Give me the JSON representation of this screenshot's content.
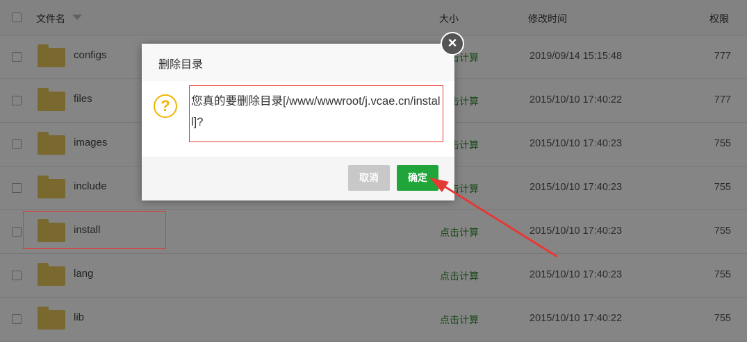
{
  "header": {
    "name": "文件名",
    "size": "大小",
    "mtime": "修改时间",
    "perm": "权限"
  },
  "rows": [
    {
      "name": "configs",
      "size": "点击计算",
      "mtime": "2019/09/14 15:15:48",
      "perm": "777"
    },
    {
      "name": "files",
      "size": "点击计算",
      "mtime": "2015/10/10 17:40:22",
      "perm": "777"
    },
    {
      "name": "images",
      "size": "点击计算",
      "mtime": "2015/10/10 17:40:23",
      "perm": "755"
    },
    {
      "name": "include",
      "size": "点击计算",
      "mtime": "2015/10/10 17:40:23",
      "perm": "755"
    },
    {
      "name": "install",
      "size": "点击计算",
      "mtime": "2015/10/10 17:40:23",
      "perm": "755"
    },
    {
      "name": "lang",
      "size": "点击计算",
      "mtime": "2015/10/10 17:40:23",
      "perm": "755"
    },
    {
      "name": "lib",
      "size": "点击计算",
      "mtime": "2015/10/10 17:40:22",
      "perm": "755"
    }
  ],
  "dialog": {
    "title": "删除目录",
    "message": "您真的要删除目录[/www/wwwroot/j.vcae.cn/install]?",
    "cancel_label": "取消",
    "ok_label": "确定"
  },
  "colors": {
    "accent_green": "#20a53a",
    "annotation_red": "#e53935",
    "folder": "#e8c95a",
    "warning": "#f0b400"
  }
}
